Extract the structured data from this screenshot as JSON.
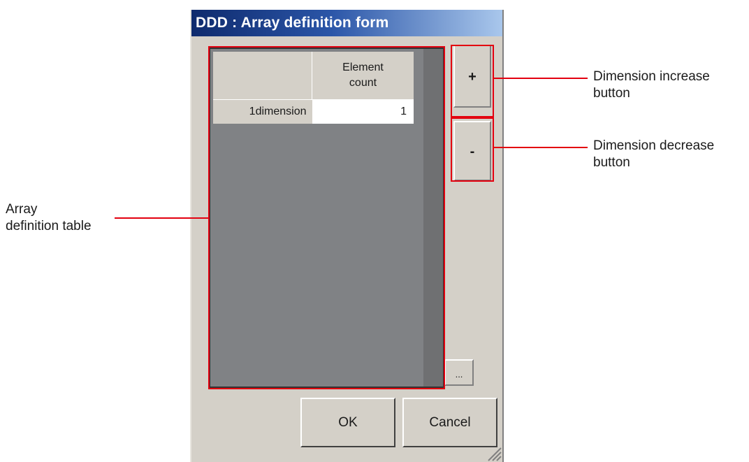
{
  "dialog": {
    "title": "DDD : Array definition form",
    "table": {
      "column_header": [
        "Element",
        "count"
      ],
      "rows": [
        {
          "label": "1dimension",
          "element_count": "1"
        }
      ]
    },
    "buttons": {
      "increase": "+",
      "decrease": "-",
      "browse": "...",
      "ok": "OK",
      "cancel": "Cancel"
    }
  },
  "callouts": {
    "increase": [
      "Dimension increase",
      "button"
    ],
    "decrease": [
      "Dimension decrease",
      "button"
    ],
    "table": [
      "Array",
      "definition table"
    ]
  },
  "colors": {
    "highlight": "#e3000f",
    "titlebar_start": "#0e2a6d",
    "titlebar_end": "#a9c7ec",
    "dialog_bg": "#d4d0c8",
    "table_bg": "#808285"
  }
}
